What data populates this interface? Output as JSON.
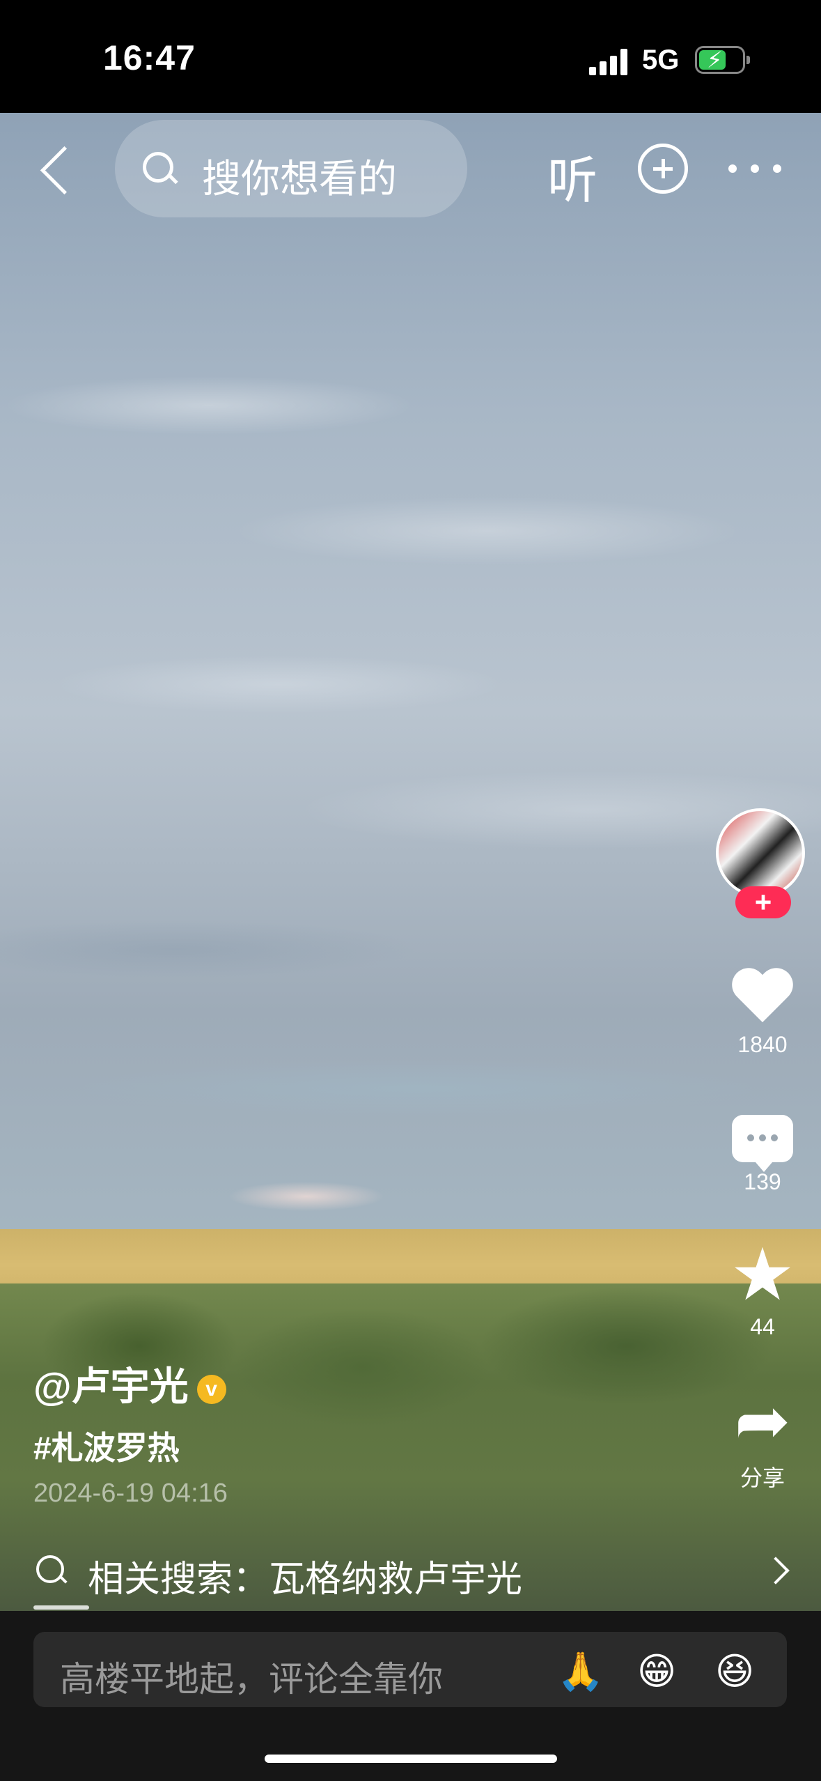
{
  "status": {
    "time": "16:47",
    "network": "5G",
    "battery_color": "#35c759"
  },
  "nav": {
    "search_placeholder": "搜你想看的",
    "listen_label": "听"
  },
  "side": {
    "follow_label": "+",
    "likes": "1840",
    "comments": "139",
    "favorites": "44",
    "share_label": "分享"
  },
  "info": {
    "author": "@卢宇光",
    "verified_badge": "v",
    "hashtag": "#札波罗热",
    "date": "2024-6-19 04:16"
  },
  "related": {
    "text": "相关搜索：瓦格纳救卢宇光"
  },
  "bottom": {
    "comment_placeholder": "高楼平地起，评论全靠你",
    "emojis": [
      "🙏",
      "😁",
      "😆"
    ]
  },
  "colors": {
    "accent": "#fe2c55",
    "verified": "#f5b921",
    "bar_bg": "#161616"
  }
}
